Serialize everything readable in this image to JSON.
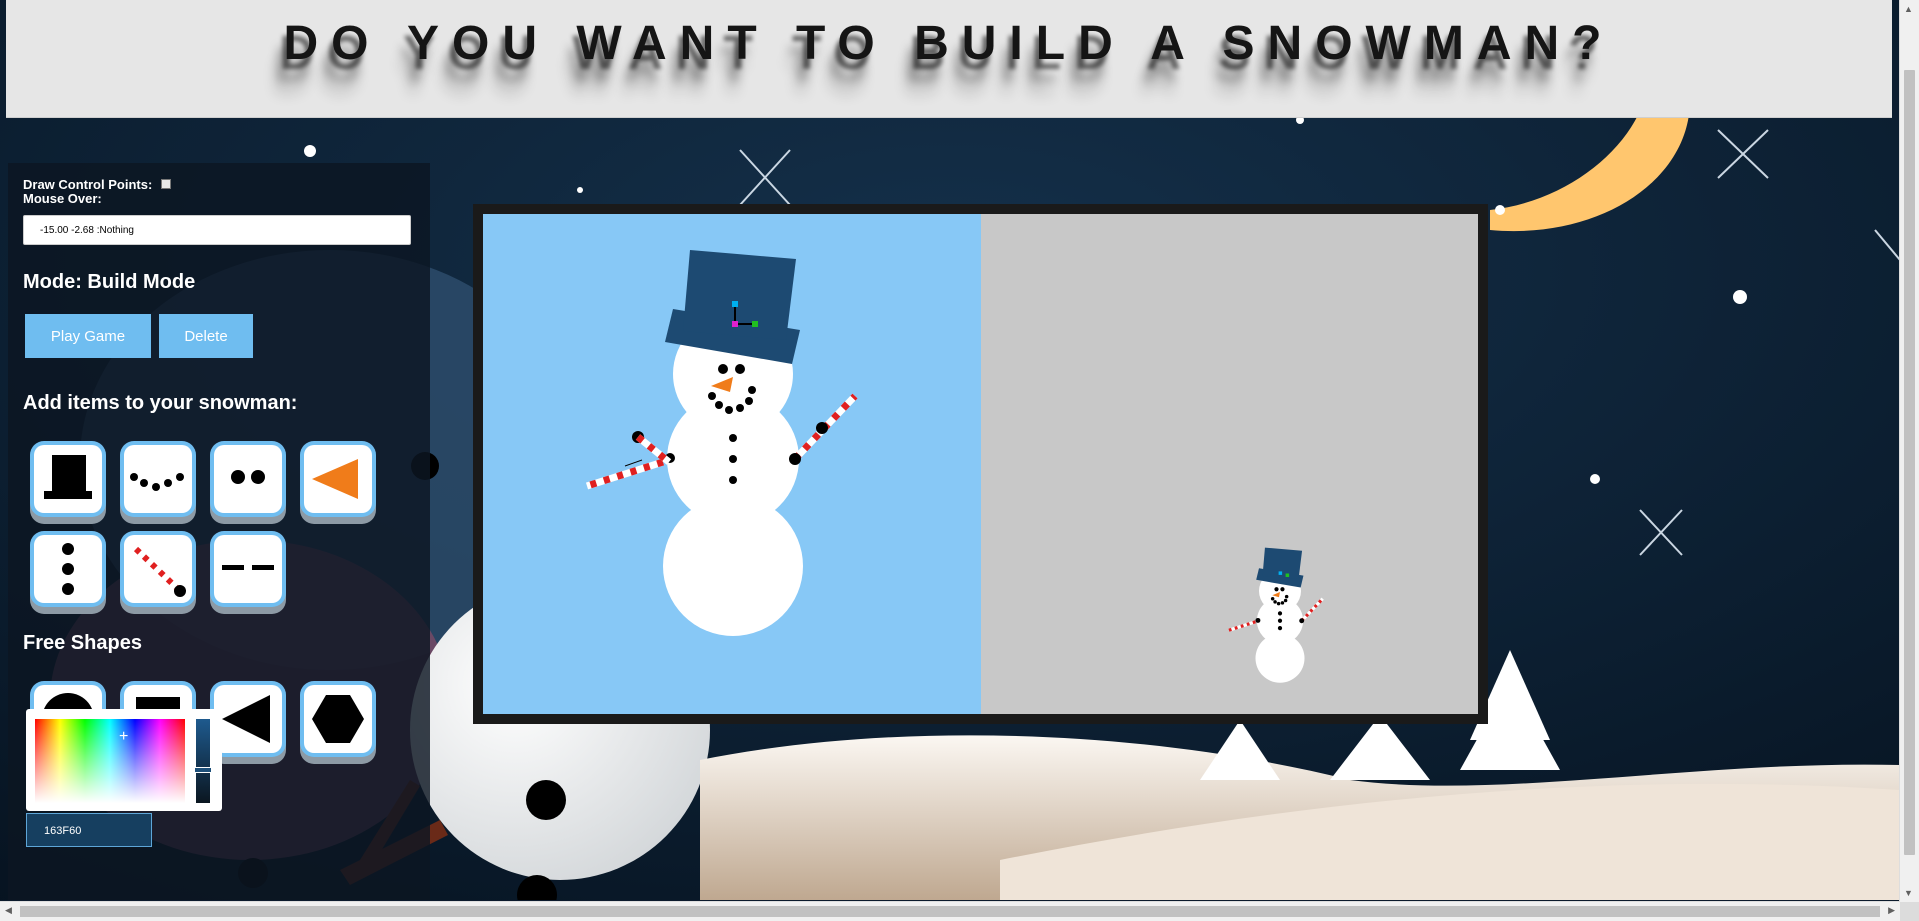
{
  "header": {
    "title": "DO YOU WANT TO BUILD A SNOWMAN?"
  },
  "panel": {
    "draw_control_points_label": "Draw Control Points:",
    "mouse_over_label": "Mouse Over:",
    "mouse_over_value": "-15.00 -2.68 :Nothing",
    "mode_text": "Mode: Build Mode",
    "play_button": "Play Game",
    "delete_button": "Delete",
    "add_items_heading": "Add items to your snowman:",
    "free_shapes_heading": "Free Shapes",
    "items": [
      {
        "icon": "top-hat-icon"
      },
      {
        "icon": "mouth-dots-icon"
      },
      {
        "icon": "eyes-icon"
      },
      {
        "icon": "carrot-nose-icon"
      },
      {
        "icon": "buttons-icon"
      },
      {
        "icon": "stick-arm-icon"
      },
      {
        "icon": "dashes-icon"
      }
    ],
    "free_shapes": [
      {
        "icon": "circle-icon"
      },
      {
        "icon": "square-icon"
      },
      {
        "icon": "triangle-icon"
      },
      {
        "icon": "hexagon-icon"
      }
    ],
    "color_hex": "163F60"
  },
  "colors": {
    "accent": "#6fbdf0",
    "hat": "#1d4a72",
    "sky": "#87c8f6",
    "preview_bg": "#c8c8c8",
    "nose": "#f07c1a"
  }
}
